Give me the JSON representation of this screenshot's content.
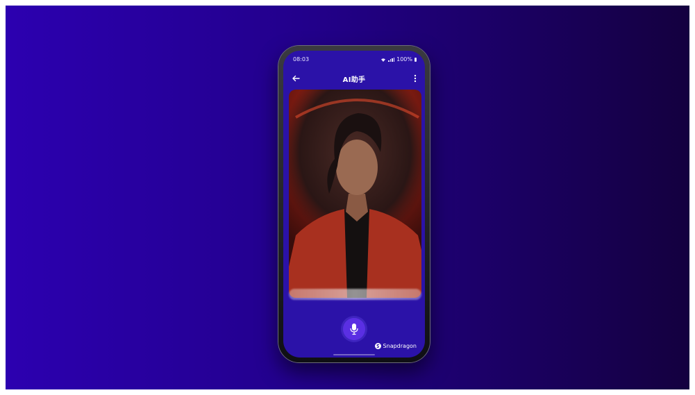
{
  "status_bar": {
    "time": "08:03",
    "battery": "100%"
  },
  "app_bar": {
    "title": "AI助手",
    "back_icon": "arrow-left-icon",
    "menu_icon": "more-vertical-icon"
  },
  "avatar": {
    "subject": "AI assistant avatar"
  },
  "controls": {
    "mic_icon": "microphone-icon"
  },
  "branding": {
    "label": "Snapdragon"
  },
  "colors": {
    "background_left": "#2c00b0",
    "background_right": "#14003f",
    "screen": "#2b12a8",
    "mic_button": "#5a2fe3",
    "avatar_backdrop": "#c0341d"
  }
}
